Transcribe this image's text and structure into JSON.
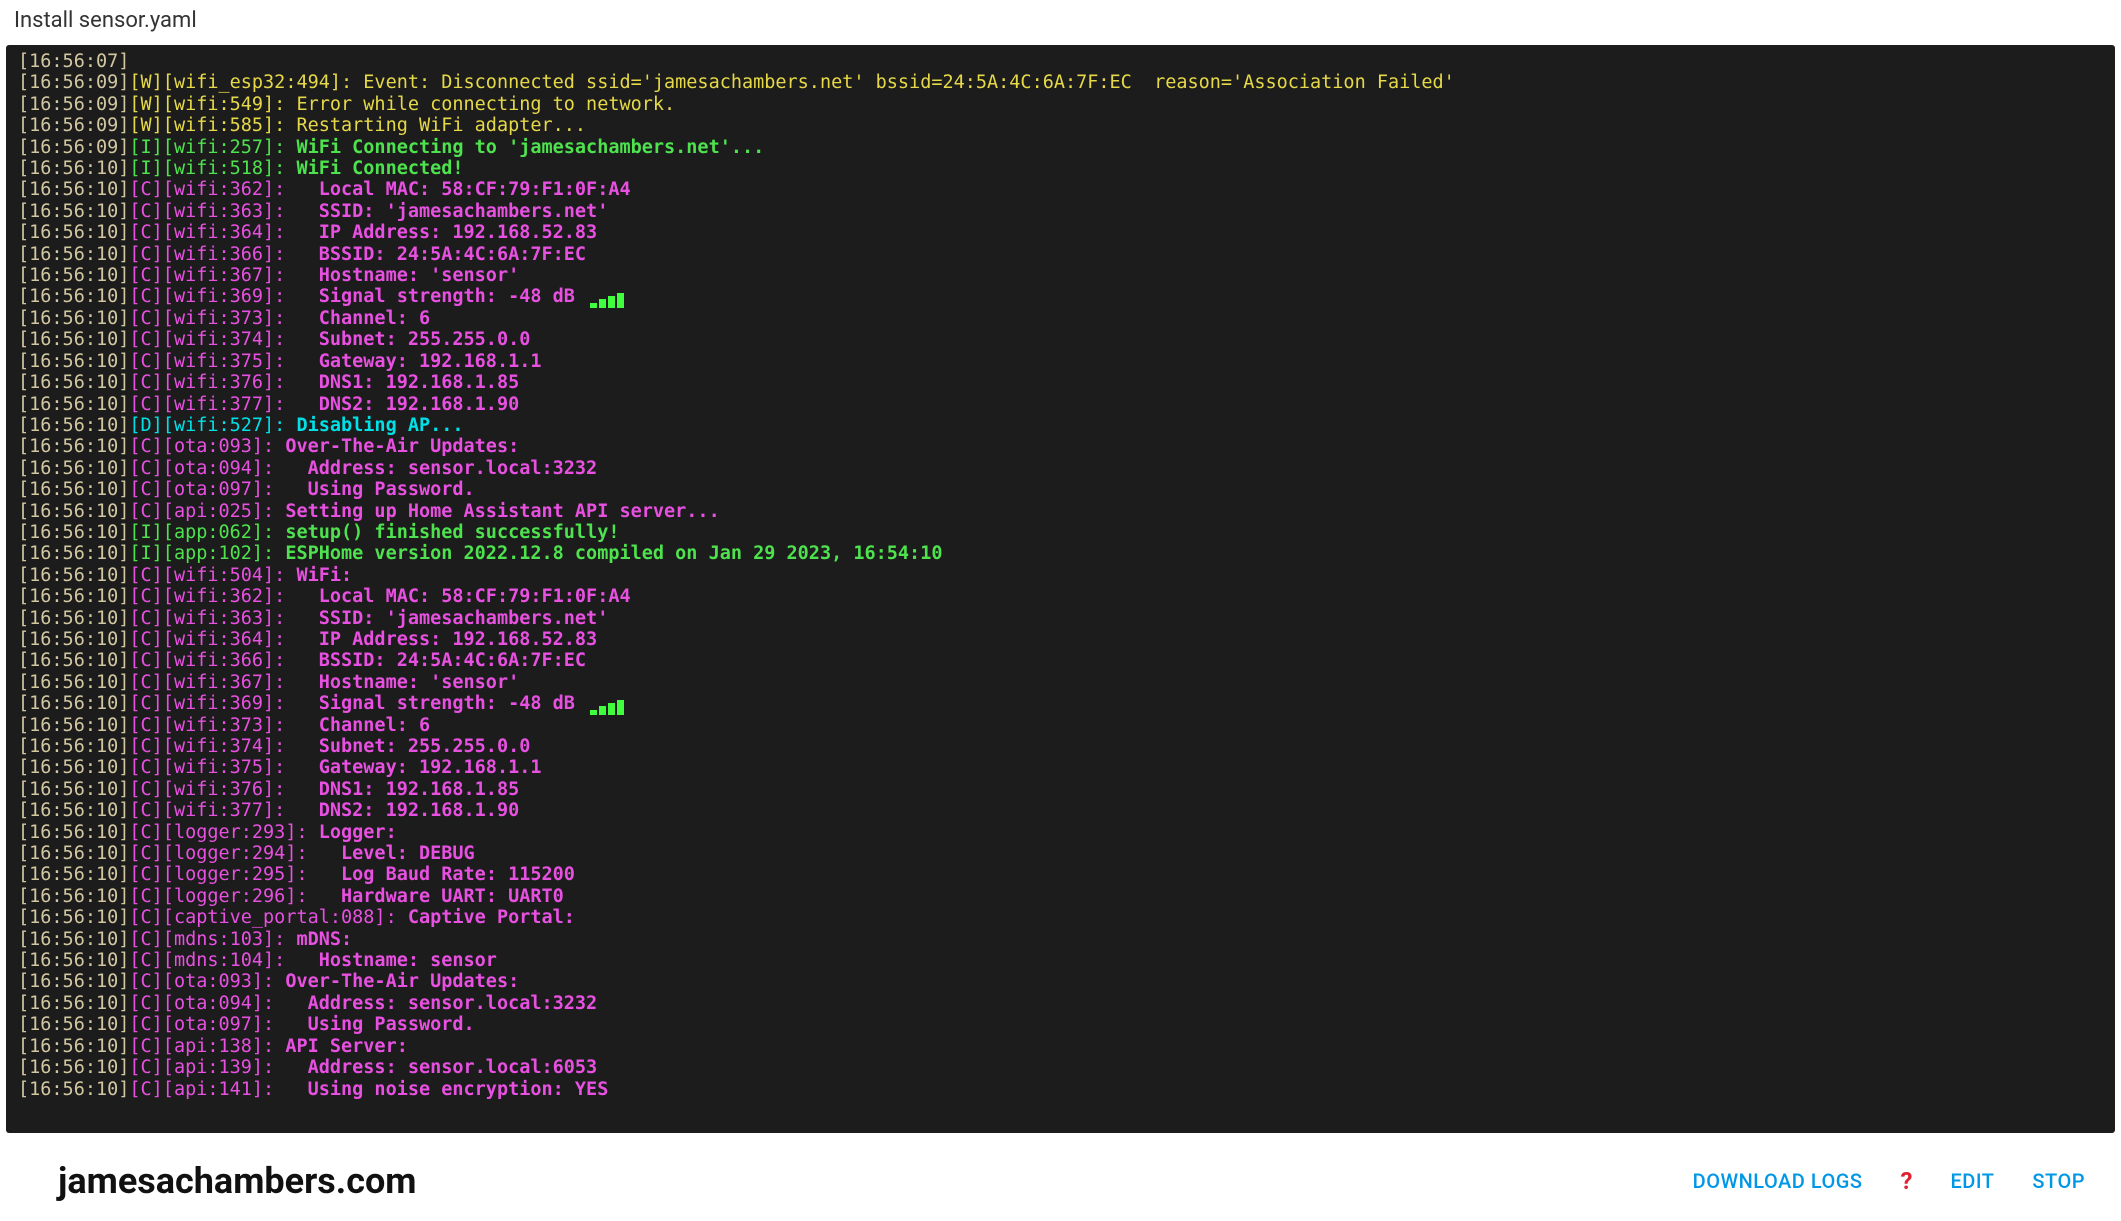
{
  "header": {
    "title": "Install sensor.yaml"
  },
  "footer": {
    "brand": "jamesachambers.com",
    "download_logs": "DOWNLOAD LOGS",
    "help": "?",
    "edit": "EDIT",
    "stop": "STOP"
  },
  "log": [
    {
      "ts": "[16:56:07]",
      "lvl": "",
      "tag": "",
      "msg": ""
    },
    {
      "ts": "[16:56:09]",
      "lvl": "W",
      "tag": "[wifi_esp32:494]",
      "msg": " Event: Disconnected ssid='jamesachambers.net' bssid=24:5A:4C:6A:7F:EC  reason='Association Failed'"
    },
    {
      "ts": "[16:56:09]",
      "lvl": "W",
      "tag": "[wifi:549]",
      "msg": " Error while connecting to network."
    },
    {
      "ts": "[16:56:09]",
      "lvl": "W",
      "tag": "[wifi:585]",
      "msg": " Restarting WiFi adapter..."
    },
    {
      "ts": "[16:56:09]",
      "lvl": "I",
      "tag": "[wifi:257]",
      "msg": " WiFi Connecting to 'jamesachambers.net'..."
    },
    {
      "ts": "[16:56:10]",
      "lvl": "I",
      "tag": "[wifi:518]",
      "msg": " WiFi Connected!"
    },
    {
      "ts": "[16:56:10]",
      "lvl": "C",
      "tag": "[wifi:362]",
      "msg": "   Local MAC: 58:CF:79:F1:0F:A4"
    },
    {
      "ts": "[16:56:10]",
      "lvl": "C",
      "tag": "[wifi:363]",
      "msg": "   SSID: 'jamesachambers.net'"
    },
    {
      "ts": "[16:56:10]",
      "lvl": "C",
      "tag": "[wifi:364]",
      "msg": "   IP Address: 192.168.52.83"
    },
    {
      "ts": "[16:56:10]",
      "lvl": "C",
      "tag": "[wifi:366]",
      "msg": "   BSSID: 24:5A:4C:6A:7F:EC"
    },
    {
      "ts": "[16:56:10]",
      "lvl": "C",
      "tag": "[wifi:367]",
      "msg": "   Hostname: 'sensor'"
    },
    {
      "ts": "[16:56:10]",
      "lvl": "C",
      "tag": "[wifi:369]",
      "msg": "   Signal strength: -48 dB ",
      "sig": true
    },
    {
      "ts": "[16:56:10]",
      "lvl": "C",
      "tag": "[wifi:373]",
      "msg": "   Channel: 6"
    },
    {
      "ts": "[16:56:10]",
      "lvl": "C",
      "tag": "[wifi:374]",
      "msg": "   Subnet: 255.255.0.0"
    },
    {
      "ts": "[16:56:10]",
      "lvl": "C",
      "tag": "[wifi:375]",
      "msg": "   Gateway: 192.168.1.1"
    },
    {
      "ts": "[16:56:10]",
      "lvl": "C",
      "tag": "[wifi:376]",
      "msg": "   DNS1: 192.168.1.85"
    },
    {
      "ts": "[16:56:10]",
      "lvl": "C",
      "tag": "[wifi:377]",
      "msg": "   DNS2: 192.168.1.90"
    },
    {
      "ts": "[16:56:10]",
      "lvl": "D",
      "tag": "[wifi:527]",
      "msg": " Disabling AP..."
    },
    {
      "ts": "[16:56:10]",
      "lvl": "C",
      "tag": "[ota:093]",
      "msg": " Over-The-Air Updates:"
    },
    {
      "ts": "[16:56:10]",
      "lvl": "C",
      "tag": "[ota:094]",
      "msg": "   Address: sensor.local:3232"
    },
    {
      "ts": "[16:56:10]",
      "lvl": "C",
      "tag": "[ota:097]",
      "msg": "   Using Password."
    },
    {
      "ts": "[16:56:10]",
      "lvl": "C",
      "tag": "[api:025]",
      "msg": " Setting up Home Assistant API server..."
    },
    {
      "ts": "[16:56:10]",
      "lvl": "I",
      "tag": "[app:062]",
      "msg": " setup() finished successfully!"
    },
    {
      "ts": "[16:56:10]",
      "lvl": "I",
      "tag": "[app:102]",
      "msg": " ESPHome version 2022.12.8 compiled on Jan 29 2023, 16:54:10"
    },
    {
      "ts": "[16:56:10]",
      "lvl": "C",
      "tag": "[wifi:504]",
      "msg": " WiFi:"
    },
    {
      "ts": "[16:56:10]",
      "lvl": "C",
      "tag": "[wifi:362]",
      "msg": "   Local MAC: 58:CF:79:F1:0F:A4"
    },
    {
      "ts": "[16:56:10]",
      "lvl": "C",
      "tag": "[wifi:363]",
      "msg": "   SSID: 'jamesachambers.net'"
    },
    {
      "ts": "[16:56:10]",
      "lvl": "C",
      "tag": "[wifi:364]",
      "msg": "   IP Address: 192.168.52.83"
    },
    {
      "ts": "[16:56:10]",
      "lvl": "C",
      "tag": "[wifi:366]",
      "msg": "   BSSID: 24:5A:4C:6A:7F:EC"
    },
    {
      "ts": "[16:56:10]",
      "lvl": "C",
      "tag": "[wifi:367]",
      "msg": "   Hostname: 'sensor'"
    },
    {
      "ts": "[16:56:10]",
      "lvl": "C",
      "tag": "[wifi:369]",
      "msg": "   Signal strength: -48 dB ",
      "sig": true
    },
    {
      "ts": "[16:56:10]",
      "lvl": "C",
      "tag": "[wifi:373]",
      "msg": "   Channel: 6"
    },
    {
      "ts": "[16:56:10]",
      "lvl": "C",
      "tag": "[wifi:374]",
      "msg": "   Subnet: 255.255.0.0"
    },
    {
      "ts": "[16:56:10]",
      "lvl": "C",
      "tag": "[wifi:375]",
      "msg": "   Gateway: 192.168.1.1"
    },
    {
      "ts": "[16:56:10]",
      "lvl": "C",
      "tag": "[wifi:376]",
      "msg": "   DNS1: 192.168.1.85"
    },
    {
      "ts": "[16:56:10]",
      "lvl": "C",
      "tag": "[wifi:377]",
      "msg": "   DNS2: 192.168.1.90"
    },
    {
      "ts": "[16:56:10]",
      "lvl": "C",
      "tag": "[logger:293]",
      "msg": " Logger:"
    },
    {
      "ts": "[16:56:10]",
      "lvl": "C",
      "tag": "[logger:294]",
      "msg": "   Level: DEBUG"
    },
    {
      "ts": "[16:56:10]",
      "lvl": "C",
      "tag": "[logger:295]",
      "msg": "   Log Baud Rate: 115200"
    },
    {
      "ts": "[16:56:10]",
      "lvl": "C",
      "tag": "[logger:296]",
      "msg": "   Hardware UART: UART0"
    },
    {
      "ts": "[16:56:10]",
      "lvl": "C",
      "tag": "[captive_portal:088]",
      "msg": " Captive Portal:"
    },
    {
      "ts": "[16:56:10]",
      "lvl": "C",
      "tag": "[mdns:103]",
      "msg": " mDNS:"
    },
    {
      "ts": "[16:56:10]",
      "lvl": "C",
      "tag": "[mdns:104]",
      "msg": "   Hostname: sensor"
    },
    {
      "ts": "[16:56:10]",
      "lvl": "C",
      "tag": "[ota:093]",
      "msg": " Over-The-Air Updates:"
    },
    {
      "ts": "[16:56:10]",
      "lvl": "C",
      "tag": "[ota:094]",
      "msg": "   Address: sensor.local:3232"
    },
    {
      "ts": "[16:56:10]",
      "lvl": "C",
      "tag": "[ota:097]",
      "msg": "   Using Password."
    },
    {
      "ts": "[16:56:10]",
      "lvl": "C",
      "tag": "[api:138]",
      "msg": " API Server:"
    },
    {
      "ts": "[16:56:10]",
      "lvl": "C",
      "tag": "[api:139]",
      "msg": "   Address: sensor.local:6053"
    },
    {
      "ts": "[16:56:10]",
      "lvl": "C",
      "tag": "[api:141]",
      "msg": "   Using noise encryption: YES"
    }
  ]
}
